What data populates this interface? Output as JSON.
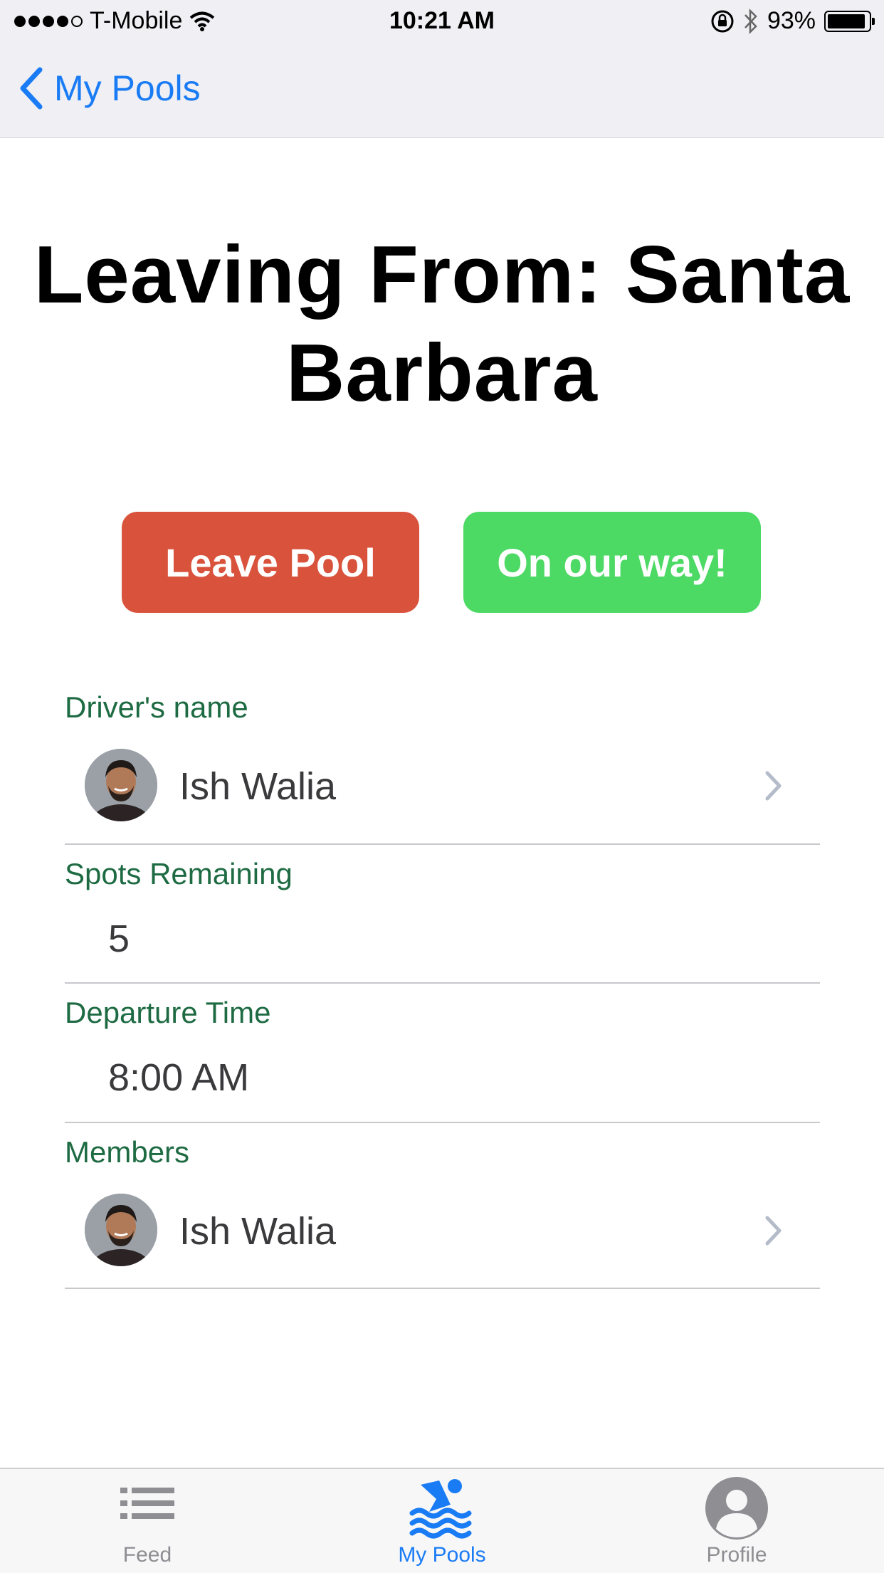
{
  "status_bar": {
    "carrier": "T-Mobile",
    "time": "10:21 AM",
    "battery": "93%",
    "battery_level": 0.93
  },
  "nav": {
    "back_label": "My Pools"
  },
  "header": {
    "title": "Leaving From: Santa Barbara"
  },
  "actions": {
    "leave_label": "Leave Pool",
    "on_way_label": "On our way!"
  },
  "details": {
    "driver_label": "Driver's name",
    "driver_name": "Ish Walia",
    "spots_label": "Spots Remaining",
    "spots_value": "5",
    "departure_label": "Departure Time",
    "departure_value": "8:00 AM",
    "members_label": "Members",
    "members": [
      {
        "name": "Ish Walia"
      }
    ]
  },
  "tabs": [
    {
      "label": "Feed",
      "icon": "list-icon"
    },
    {
      "label": "My Pools",
      "icon": "swimmer-icon"
    },
    {
      "label": "Profile",
      "icon": "user-icon"
    }
  ],
  "colors": {
    "accent": "#1a7cf5",
    "leave": "#d9533c",
    "go": "#4cd964",
    "section_label": "#1e6b43"
  }
}
